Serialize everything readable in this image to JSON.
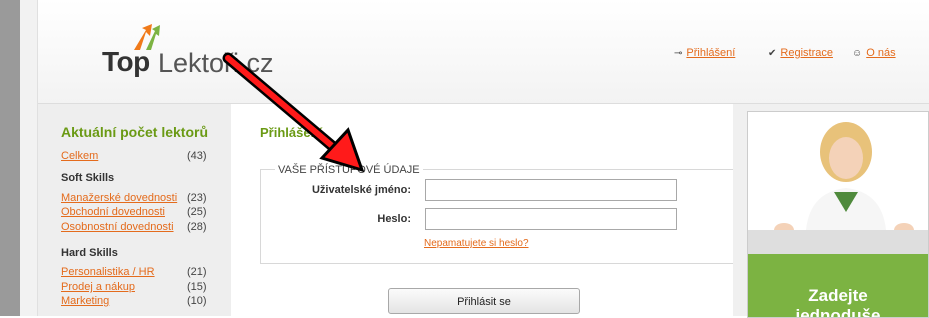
{
  "header": {
    "logo": {
      "part1": "Top",
      "part2": "Lektoři.cz"
    },
    "nav": [
      {
        "label": "Přihlášení",
        "icon": "key-icon"
      },
      {
        "label": "Registrace",
        "icon": "check-icon"
      },
      {
        "label": "O nás",
        "icon": "people-icon"
      }
    ]
  },
  "sidebar": {
    "title": "Aktuální počet lektorů",
    "total": {
      "label": "Celkem",
      "count": "(43)"
    },
    "sections": [
      {
        "title": "Soft Skills",
        "items": [
          {
            "label": "Manažerské dovednosti",
            "count": "(23)"
          },
          {
            "label": "Obchodní dovednosti",
            "count": "(25)"
          },
          {
            "label": "Osobnostní dovednosti",
            "count": "(28)"
          }
        ]
      },
      {
        "title": "Hard Skills",
        "items": [
          {
            "label": "Personalistika / HR",
            "count": "(21)"
          },
          {
            "label": "Prodej a nákup",
            "count": "(15)"
          },
          {
            "label": "Marketing",
            "count": "(10)"
          }
        ]
      }
    ]
  },
  "main": {
    "title": "Přihlášení",
    "legend": "VAŠE PŘÍSTUPOVÉ ÚDAJE",
    "username_label": "Uživatelské jméno:",
    "username_value": "",
    "password_label": "Heslo:",
    "password_value": "",
    "forgot_link": "Nepamatujete si heslo?",
    "submit_label": "Přihlásit se"
  },
  "banner": {
    "text_line1": "Zadejte",
    "text_line2": "jednoduše"
  },
  "colors": {
    "accent_green": "#6a9a14",
    "link_orange": "#e46b1c",
    "annotation_arrow": "#ff0000",
    "banner_green": "#7cb342"
  }
}
